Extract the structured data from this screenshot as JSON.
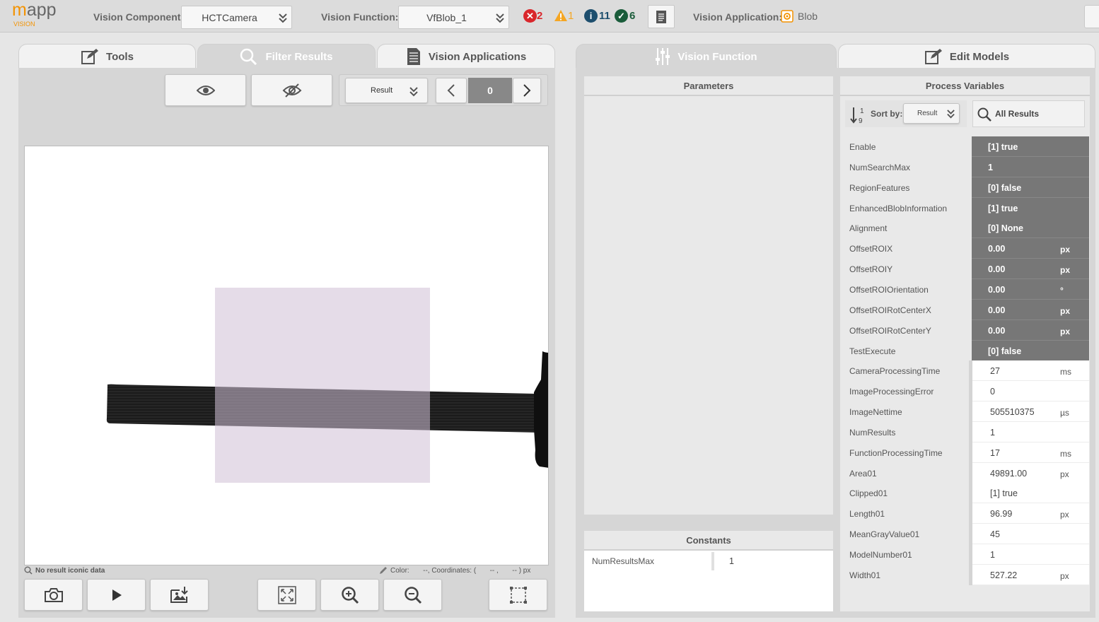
{
  "header": {
    "logo_main": "mapp",
    "logo_sub": "VISION",
    "vision_component_label": "Vision Component:",
    "vision_component_value": "HCTCamera",
    "vision_function_label": "Vision Function:",
    "vision_function_value": "VfBlob_1",
    "errors": "2",
    "warnings": "1",
    "info": "11",
    "success": "6",
    "vision_application_label": "Vision Application:",
    "vision_application_value": "Blob"
  },
  "left_tabs": [
    {
      "label": "Tools",
      "icon": "edit-icon"
    },
    {
      "label": "Filter Results",
      "icon": "search-icon"
    },
    {
      "label": "Vision Applications",
      "icon": "document-icon"
    }
  ],
  "right_tabs": [
    {
      "label": "Vision Function",
      "icon": "sliders-icon"
    },
    {
      "label": "Edit Models",
      "icon": "edit-icon"
    }
  ],
  "filter": {
    "result_select": "Result",
    "index": "0"
  },
  "image_status": {
    "left": "No result iconic data",
    "right": "Color:       --, Coordinates: (       -- ,       -- ) px"
  },
  "parameters": {
    "title": "Parameters"
  },
  "constants": {
    "title": "Constants",
    "rows": [
      {
        "name": "NumResultsMax",
        "value": "1"
      }
    ]
  },
  "process_variables": {
    "title": "Process Variables",
    "sort_label": "Sort by:",
    "sort_value": "Result",
    "sort_icon_text": "1 9",
    "filter_value": "All Results",
    "rows": [
      {
        "name": "Enable",
        "value": "[1] true",
        "unit": ""
      },
      {
        "name": "NumSearchMax",
        "value": "1",
        "unit": ""
      },
      {
        "name": "RegionFeatures",
        "value": "[0] false",
        "unit": ""
      },
      {
        "name": "EnhancedBlobInformation",
        "value": "[1] true",
        "unit": ""
      },
      {
        "name": "Alignment",
        "value": "[0] None",
        "unit": ""
      },
      {
        "name": "OffsetROIX",
        "value": "0.00",
        "unit": "px"
      },
      {
        "name": "OffsetROIY",
        "value": "0.00",
        "unit": "px"
      },
      {
        "name": "OffsetROIOrientation",
        "value": "0.00",
        "unit": "°"
      },
      {
        "name": "OffsetROIRotCenterX",
        "value": "0.00",
        "unit": "px"
      },
      {
        "name": "OffsetROIRotCenterY",
        "value": "0.00",
        "unit": "px"
      },
      {
        "name": "TestExecute",
        "value": "[0] false",
        "unit": ""
      },
      {
        "name": "CameraProcessingTime",
        "value": "27",
        "unit": "ms"
      },
      {
        "name": "ImageProcessingError",
        "value": "0",
        "unit": ""
      },
      {
        "name": "ImageNettime",
        "value": "505510375",
        "unit": "µs"
      },
      {
        "name": "NumResults",
        "value": "1",
        "unit": ""
      },
      {
        "name": "FunctionProcessingTime",
        "value": "17",
        "unit": "ms"
      },
      {
        "name": "Area01",
        "value": "49891.00",
        "unit": "px"
      },
      {
        "name": "Clipped01",
        "value": "[1] true",
        "unit": ""
      },
      {
        "name": "Length01",
        "value": "96.99",
        "unit": "px"
      },
      {
        "name": "MeanGrayValue01",
        "value": "45",
        "unit": ""
      },
      {
        "name": "ModelNumber01",
        "value": "1",
        "unit": ""
      },
      {
        "name": "Width01",
        "value": "527.22",
        "unit": "px"
      }
    ]
  },
  "colors": {
    "accent": "#f39200",
    "error": "#d9262b",
    "warning": "#f5a623",
    "info": "#1d4e6d",
    "success": "#1a5c3a"
  }
}
